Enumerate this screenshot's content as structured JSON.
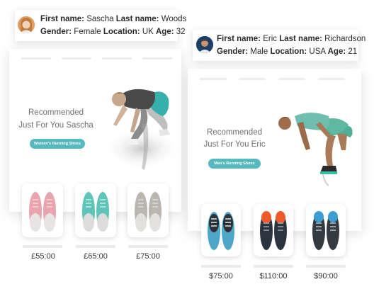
{
  "profiles": [
    {
      "first_name_label": "First name:",
      "first_name": "Sascha",
      "last_name_label": "Last name:",
      "last_name": "Woods",
      "gender_label": "Gender:",
      "gender": "Female",
      "location_label": "Location:",
      "location": "UK",
      "age_label": "Age:",
      "age": "32",
      "avatar_color": "#e8a46a"
    },
    {
      "first_name_label": "First name:",
      "first_name": "Eric",
      "last_name_label": "Last name:",
      "last_name": "Richardson",
      "gender_label": "Gender:",
      "gender": "Male",
      "location_label": "Location:",
      "location": "USA",
      "age_label": "Age:",
      "age": "21",
      "avatar_color": "#2d5e8c"
    }
  ],
  "cards": [
    {
      "headline_1": "Recommended",
      "headline_2": "Just For You Sascha",
      "cta": "Women's Running Shoes",
      "prices": [
        "£55:00",
        "£65:00",
        "£75:00"
      ],
      "shoe_colors": [
        "#e9a4ae",
        "#5dc4b7",
        "#b9b6b0"
      ]
    },
    {
      "headline_1": "Recommended",
      "headline_2": "Just For You Eric",
      "cta": "Men's Running Shoes",
      "prices": [
        "$75:00",
        "$110:00",
        "$90:00"
      ],
      "shoe_colors": [
        "#4ea6c9",
        "#ee5a2a",
        "#3a9fd0"
      ]
    }
  ],
  "accent_color": "#56b9bd"
}
